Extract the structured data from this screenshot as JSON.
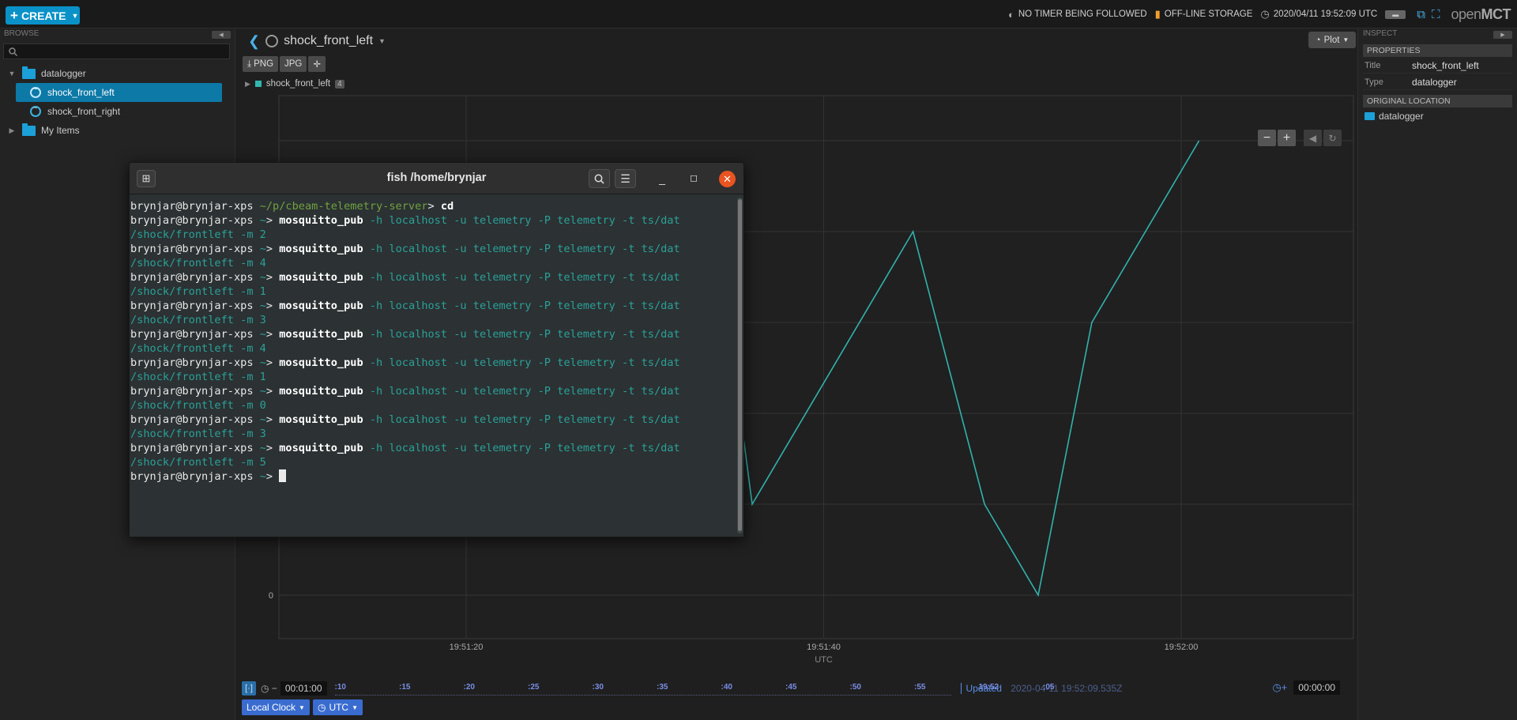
{
  "topbar": {
    "create_label": "CREATE",
    "timer_status": "NO TIMER BEING FOLLOWED",
    "storage_status": "OFF-LINE STORAGE",
    "clock": "2020/04/11 19:52:09 UTC",
    "logo_open": "open",
    "logo_mct": "MCT"
  },
  "browse": {
    "header": "BROWSE",
    "search_placeholder": "",
    "tree": [
      {
        "label": "datalogger"
      },
      {
        "label": "shock_front_left"
      },
      {
        "label": "shock_front_right"
      },
      {
        "label": "My Items"
      }
    ]
  },
  "main": {
    "object_title": "shock_front_left",
    "view_label": "Plot",
    "export_png": "PNG",
    "export_jpg": "JPG",
    "legend_name": "shock_front_left",
    "legend_badge": "4"
  },
  "chart_data": {
    "type": "line",
    "x": [
      "19:51:20",
      "19:51:40",
      "19:52:00"
    ],
    "x_ticks": [
      "19:51:20",
      "19:51:40",
      "19:52:00"
    ],
    "xlabel": "UTC",
    "y_ticks": [
      "0"
    ],
    "series": [
      {
        "color": "#31b3ad",
        "points": [
          {
            "t": "19:51:27",
            "v": 3
          },
          {
            "t": "19:51:34",
            "v": 4
          },
          {
            "t": "19:51:36",
            "v": 1
          },
          {
            "t": "19:51:45",
            "v": 4
          },
          {
            "t": "19:51:49",
            "v": 1
          },
          {
            "t": "19:51:52",
            "v": 0
          },
          {
            "t": "19:51:55",
            "v": 3
          },
          {
            "t": "19:52:01",
            "v": 5
          }
        ]
      }
    ],
    "grid": true
  },
  "time_conductor": {
    "start_offset": "00:01:00",
    "end_offset": "00:00:00",
    "ticks": [
      ":10",
      ":15",
      ":20",
      ":25",
      ":30",
      ":35",
      ":40",
      ":45",
      ":50",
      ":55",
      "19:52",
      ":05"
    ],
    "updated_label": "Updated",
    "updated_time": "2020-04-11 19:52:09.535Z",
    "clock_label": "Local Clock",
    "timesystem_label": "UTC"
  },
  "inspector": {
    "header": "INSPECT",
    "properties_label": "PROPERTIES",
    "title_key": "Title",
    "title_value": "shock_front_left",
    "type_key": "Type",
    "type_value": "datalogger",
    "location_label": "ORIGINAL LOCATION",
    "location_value": "datalogger"
  },
  "terminal": {
    "title": "fish /home/brynjar",
    "user": "brynjar@brynjar-xps",
    "first_path": "~/p/cbeam-telemetry-server",
    "first_cmd": "cd",
    "tilde": "~",
    "cmd": "mosquitto_pub",
    "args": "-h localhost -u telemetry -P telemetry -t ts/dat",
    "topic_tail": "/shock/frontleft -m",
    "values": [
      "2",
      "4",
      "1",
      "3",
      "4",
      "1",
      "0",
      "3",
      "5"
    ]
  }
}
